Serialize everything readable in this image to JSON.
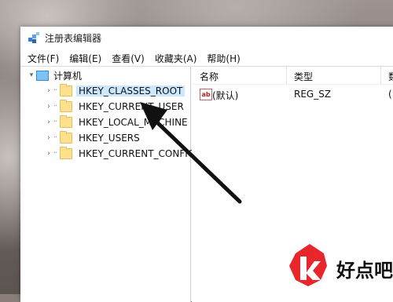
{
  "window": {
    "title": "注册表编辑器",
    "icon": "registry-editor-icon"
  },
  "menu": [
    "文件(F)",
    "编辑(E)",
    "查看(V)",
    "收藏夹(A)",
    "帮助(H)"
  ],
  "tree": {
    "root": "计算机",
    "items": [
      {
        "label": "HKEY_CLASSES_ROOT",
        "selected": true
      },
      {
        "label": "HKEY_CURRENT_USER",
        "selected": false
      },
      {
        "label": "HKEY_LOCAL_MACHINE",
        "selected": false
      },
      {
        "label": "HKEY_USERS",
        "selected": false
      },
      {
        "label": "HKEY_CURRENT_CONFIG",
        "selected": false
      }
    ]
  },
  "list": {
    "headers": {
      "name": "名称",
      "type": "类型",
      "data": "数"
    },
    "rows": [
      {
        "icon": "string-value-icon",
        "icon_text": "ab",
        "name": "(默认)",
        "type": "REG_SZ",
        "data": "("
      }
    ]
  },
  "watermark": {
    "text": "好点吧"
  },
  "colors": {
    "selection": "#cce8ff",
    "folder": "#ffe08c",
    "watermark_red": "#e8262b"
  }
}
